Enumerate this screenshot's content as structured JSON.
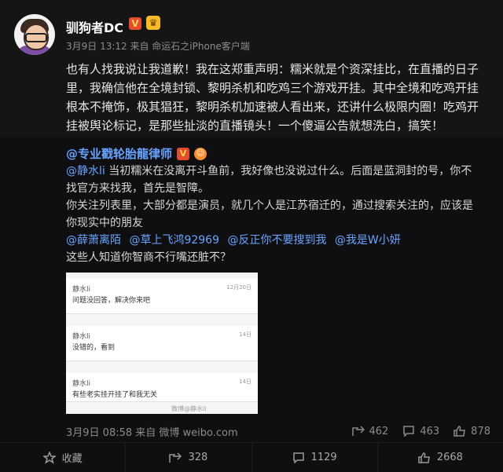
{
  "post": {
    "username": "驯狗者DC",
    "meta": "3月9日 13:12 来自 命运石之iPhone客户端",
    "text_lines": [
      "也有人找我说让我道歉！我在这郑重声明：糯米就是个资深挂比，在直播的日子",
      "里，我确信他在全境封锁、黎明杀机和吃鸡三个游戏开挂。其中全境和吃鸡开挂",
      "根本不掩饰，极其猖狂，黎明杀机加速被人看出来，还讲什么极限内圈！吃鸡开",
      "挂被舆论标记，是那些扯淡的直播镜头！一个傻逼公告就想洗白，搞笑！"
    ]
  },
  "repost": {
    "author": "@专业戳轮胎龍律师",
    "line1_mention": "@静水li",
    "line1_text": " 当初糯米在没离开斗鱼前，我好像也没说过什么。后面是蓝洞封的号，你不",
    "line2": "找官方来找我，首先是智障。",
    "line3": "你关注列表里，大部分都是演员，就几个人是江苏宿迁的，通过搜索关注的，应该是",
    "line4": "你现实中的朋友",
    "mentions": [
      "@薛萧离陌",
      "@草上飞鸿92969",
      "@反正你不要搜到我",
      "@我是W小妍"
    ],
    "line5": "这些人知道你智商不行嘴还脏不？",
    "footer_source": "3月9日 08:58 来自 微博 weibo.com",
    "stats": {
      "forwards": "462",
      "comments": "463",
      "likes": "878"
    },
    "screenshot": {
      "cards": [
        {
          "name": "静水li",
          "text": "问题没回答，解决你来吧",
          "date": "12月20日"
        },
        {
          "name": "静水li",
          "text": "没错的，看到",
          "date": "14日"
        },
        {
          "name": "静水li",
          "text": "有些老实挂开挂了和我无关",
          "date": "14日"
        }
      ],
      "watermark": "微博@静水li"
    }
  },
  "bottom_bar": {
    "favorite": "收藏",
    "forward": "328",
    "comment": "1129",
    "like": "2668"
  }
}
